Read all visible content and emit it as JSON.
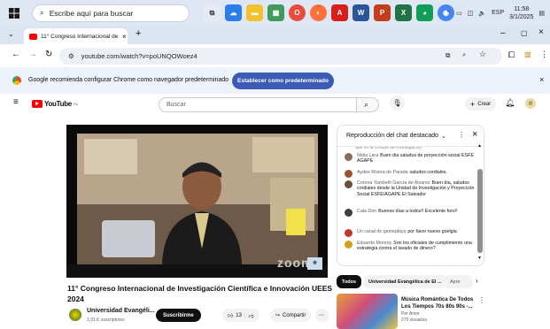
{
  "taskbar": {
    "search_placeholder": "Escribe aquí para buscar",
    "lang": "ESP",
    "time": "11:58",
    "date": "3/1/2025"
  },
  "browser": {
    "tab_title": "11° Congreso Internacional de I",
    "url": "youtube.com/watch?v=poUNQOWoez4"
  },
  "infobar": {
    "message": "Google recomienda configurar Chrome como navegador predeterminado",
    "button": "Establecer como predeterminado"
  },
  "youtube": {
    "logo": "YouTube",
    "region": "SV",
    "search_placeholder": "Buscar",
    "create_label": "Crear"
  },
  "video": {
    "title_line1": "11° Congreso Internacional de Investigación Científica e Innovación UEES",
    "title_line2": "2024",
    "channel": "Universidad Evangéli...",
    "subscribers": "1,91 K suscriptores",
    "subscribe": "Suscribirme",
    "likes": "13",
    "share": "Compartir",
    "zoom_mark": "zoom"
  },
  "chat": {
    "title": "Reproducción del chat destacado",
    "cut_line": "que en la Unidad de Investigacion",
    "messages": [
      {
        "author": "Nidia Lara",
        "text": "Buen día saludos de proyección social ESFE AGAPE",
        "color": "#8a6a5a"
      },
      {
        "author": "Aydee Rivera de Parada",
        "text": "saludos cordiales.",
        "color": "#a0522d"
      },
      {
        "author": "Corona Yamileth García de Alvarez",
        "text": "Buen día, saludos cordiales desde la Unidad de Investigación y Proyección Social ESFE/ÁGAPE El Salvador",
        "color": "#6b4e3d"
      },
      {
        "author": "Cala Don",
        "text": "Buenos días a todos!! Excelente foro!!",
        "color": "#3d3d3d"
      },
      {
        "author": "Un canal de gameplays",
        "text": "por favor nuevo goelgia",
        "color": "#c0392b"
      },
      {
        "author": "Eduardo Monroy",
        "text": "Son los oficiales de cumplimiento una estrategia contra el lavado de dinero?",
        "color": "#d4a017"
      }
    ]
  },
  "filters": [
    "Todos",
    "Universidad Evangélica de El ...",
    "Apre"
  ],
  "recommendation": {
    "title_line1": "Música Romántica De Todos",
    "title_line2": "Los Tiempos 70s 80s 90s -...",
    "channel": "Per Amor",
    "views": "270 visualiza"
  }
}
